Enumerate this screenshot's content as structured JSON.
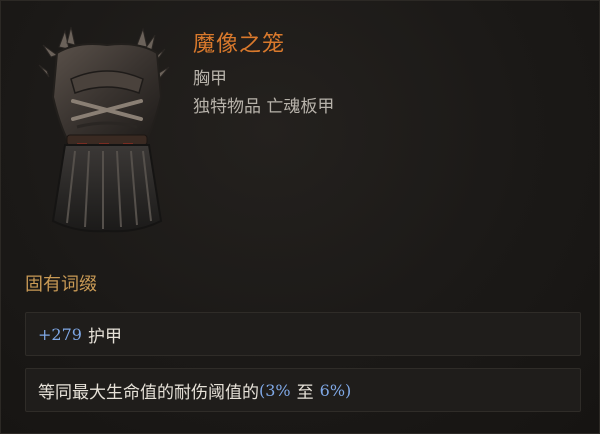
{
  "item": {
    "name": "魔像之笼",
    "slot": "胸甲",
    "type": "独特物品 亡魂板甲",
    "art_icon": "chest-armor-icon"
  },
  "implicit": {
    "title": "固有词缀"
  },
  "affixes": [
    {
      "value": "+279",
      "label": "护甲"
    },
    {
      "label": "等同最大生命值的耐伤阈值的",
      "range_open": "(",
      "min": "3%",
      "to": "至",
      "max": "6%",
      "range_close": ")"
    }
  ],
  "colors": {
    "name": "#d9792c",
    "base": "#b7b2aa",
    "section": "#c99a55",
    "number": "#7fa8e6",
    "affix_text": "#e6e1d8"
  }
}
